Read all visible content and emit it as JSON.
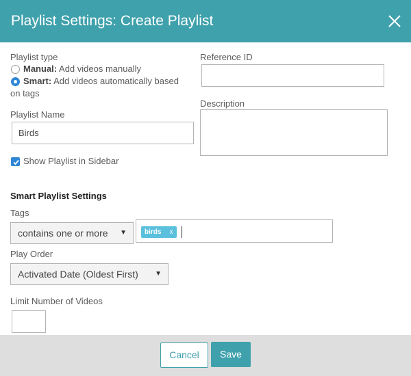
{
  "header": {
    "title": "Playlist Settings: Create Playlist",
    "close_icon": "close-icon",
    "background_color": "#3fa1ac"
  },
  "playlist_type": {
    "label": "Playlist type",
    "options": [
      {
        "name": "Manual:",
        "description": "Add videos manually",
        "selected": false
      },
      {
        "name": "Smart:",
        "description_line1": "Add videos automatically based",
        "description_line2": "on tags",
        "selected": true
      }
    ]
  },
  "reference_id": {
    "label": "Reference ID",
    "value": ""
  },
  "playlist_name": {
    "label": "Playlist Name",
    "value": "Birds"
  },
  "description": {
    "label": "Description",
    "value": ""
  },
  "sidebar_option": {
    "label": "Show Playlist in Sidebar",
    "checked": true
  },
  "smart_settings": {
    "title": "Smart Playlist Settings",
    "tags": {
      "label": "Tags",
      "match_mode": "contains one or more",
      "chips": [
        {
          "text": "birds",
          "remove": "x"
        }
      ],
      "chip_color": "#5bc0de"
    },
    "play_order": {
      "label": "Play Order",
      "value": "Activated Date (Oldest First)"
    },
    "limit": {
      "label": "Limit Number of Videos",
      "value": ""
    }
  },
  "footer": {
    "cancel_label": "Cancel",
    "save_label": "Save",
    "accent_color": "#3fa1ac"
  }
}
